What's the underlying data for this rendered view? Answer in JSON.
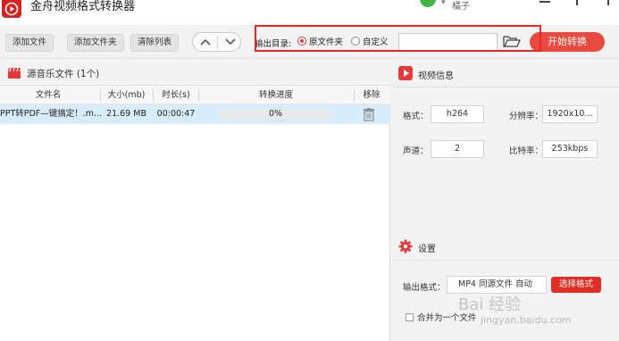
{
  "app": {
    "title": "金舟视频格式转换器",
    "user_name": "橘子"
  },
  "toolbar": {
    "add_file": "添加文件",
    "add_folder": "添加文件夹",
    "clear_list": "清除列表",
    "output_dir_label": "输出目录:",
    "radio_original": "原文件夹",
    "radio_custom": "自定义",
    "path_value": "",
    "start_button": "开始转换"
  },
  "file_panel": {
    "title": "源音乐文件 (1个)",
    "columns": {
      "name": "文件名",
      "size": "大小(mb)",
      "duration": "时长(s)",
      "progress": "转换进度",
      "remove": "移除"
    },
    "rows": [
      {
        "name": "PPT转PDF—键搞定！.m...",
        "size": "21.69 MB",
        "duration": "00:00:47",
        "progress_text": "0%",
        "progress_fraction": 0.0
      }
    ]
  },
  "video_info": {
    "title": "视频信息",
    "format_label": "格式：",
    "format_value": "h264",
    "resolution_label": "分辨率：",
    "resolution_value": "1920x10...",
    "channel_label": "声道：",
    "channel_value": "2",
    "bitrate_label": "比特率：",
    "bitrate_value": "253kbps"
  },
  "settings": {
    "title": "设置",
    "output_format_label": "输出格式：",
    "output_format_value": "MP4 同源文件 自动",
    "choose_format_button": "选择格式",
    "merge_label": "合并为一个文件"
  },
  "watermark": {
    "text": "Bai 经验",
    "url": "jingyan.baidu.com"
  },
  "colors": {
    "accent_red": "#e84a3f",
    "selection_blue": "#d8edfb",
    "highlight_border": "#e6262a"
  }
}
